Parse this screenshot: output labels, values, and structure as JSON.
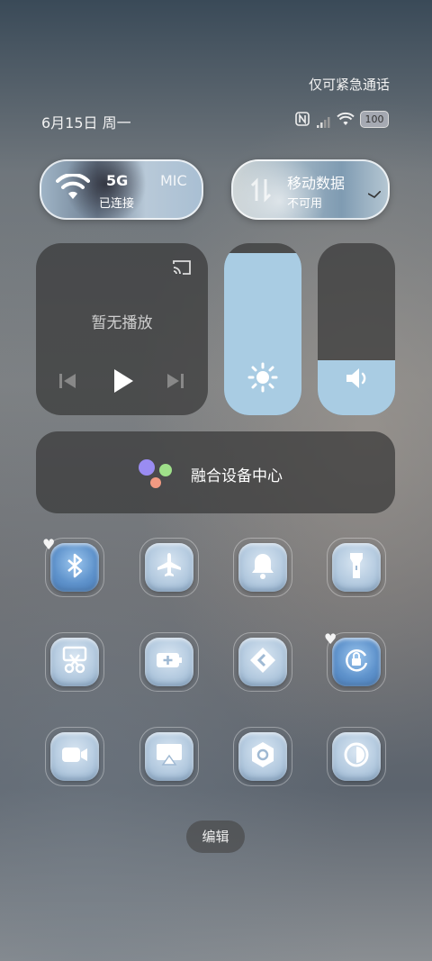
{
  "status": {
    "emergency": "仅可紧急通话",
    "date": "6月15日 周一",
    "battery": "100"
  },
  "wifi_tile": {
    "label": "5G",
    "label2": "MIC",
    "status": "已连接"
  },
  "data_tile": {
    "label": "移动数据",
    "status": "不可用"
  },
  "media": {
    "status": "暂无播放"
  },
  "sliders": {
    "brightness": 0.94,
    "volume": 0.32
  },
  "device_center": {
    "label": "融合设备中心"
  },
  "tiles": [
    {
      "icon": "bluetooth-icon",
      "active": true
    },
    {
      "icon": "airplane-icon",
      "active": false
    },
    {
      "icon": "bell-icon",
      "active": false
    },
    {
      "icon": "flashlight-icon",
      "active": false
    },
    {
      "icon": "screenshot-icon",
      "active": false
    },
    {
      "icon": "battery-saver-icon",
      "active": false
    },
    {
      "icon": "share-icon",
      "active": false
    },
    {
      "icon": "rotation-lock-icon",
      "active": true
    },
    {
      "icon": "video-icon",
      "active": false
    },
    {
      "icon": "cast-icon",
      "active": false
    },
    {
      "icon": "nfc-icon",
      "active": false
    },
    {
      "icon": "dark-mode-icon",
      "active": false
    }
  ],
  "edit": {
    "label": "编辑"
  },
  "colors": {
    "slider_fill": "#a9cce3",
    "tile_active": "#5f93cc"
  }
}
